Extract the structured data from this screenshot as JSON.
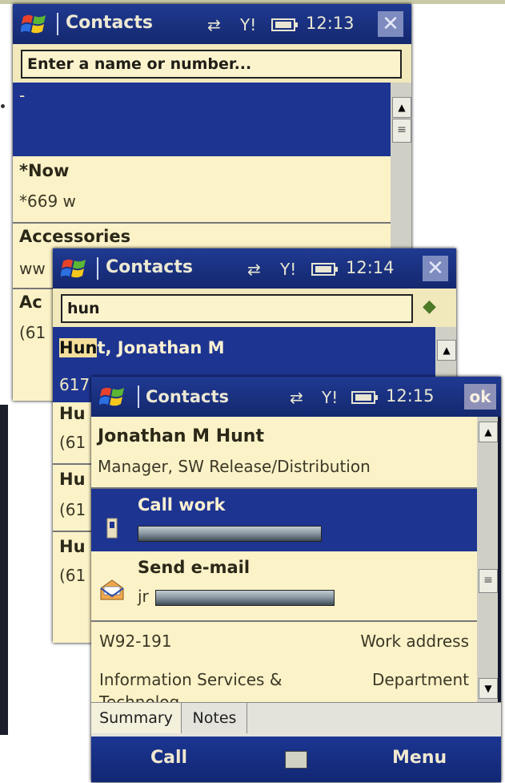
{
  "screen1": {
    "title": "Contacts",
    "time": "12:13",
    "search_placeholder": "Enter a name or number...",
    "first_row": "-",
    "contacts": [
      {
        "name": "*Now",
        "detail": "*669   w"
      },
      {
        "name": "Accessories",
        "detail": "ww"
      },
      {
        "name": "Ac",
        "detail": "(61"
      }
    ]
  },
  "screen2": {
    "title": "Contacts",
    "time": "12:14",
    "search_value": "hun",
    "first_match_highlight": "Hun",
    "first_match_rest": "t, Jonathan M",
    "first_detail": "617",
    "rows": [
      {
        "name": "Hu",
        "detail": "(61"
      },
      {
        "name": "Hu",
        "detail": "(61"
      },
      {
        "name": "Hu",
        "detail": "(61"
      }
    ]
  },
  "screen3": {
    "title": "Contacts",
    "time": "12:15",
    "ok_label": "ok",
    "contact_name": "Jonathan M Hunt",
    "contact_title": "Manager, SW Release/Distribution",
    "call_label": "Call work",
    "email_label": "Send e-mail",
    "email_prefix": "jr",
    "office_value": "W92-191",
    "office_label": "Work address",
    "department_value": "Information Services &",
    "department_label": "Department",
    "department_overflow": "Technolog",
    "tabs": [
      "Summary",
      "Notes"
    ],
    "menu_left": "Call",
    "menu_right": "Menu"
  },
  "colors": {
    "titlebar": "#1a3286",
    "selection": "#1d3491",
    "list_bg": "#fbf2c8"
  },
  "icons": [
    "windows-logo-icon",
    "sync-icon",
    "signal-icon",
    "battery-icon",
    "close-icon",
    "phone-icon",
    "email-icon",
    "keyboard-icon",
    "go-arrow-icon"
  ]
}
